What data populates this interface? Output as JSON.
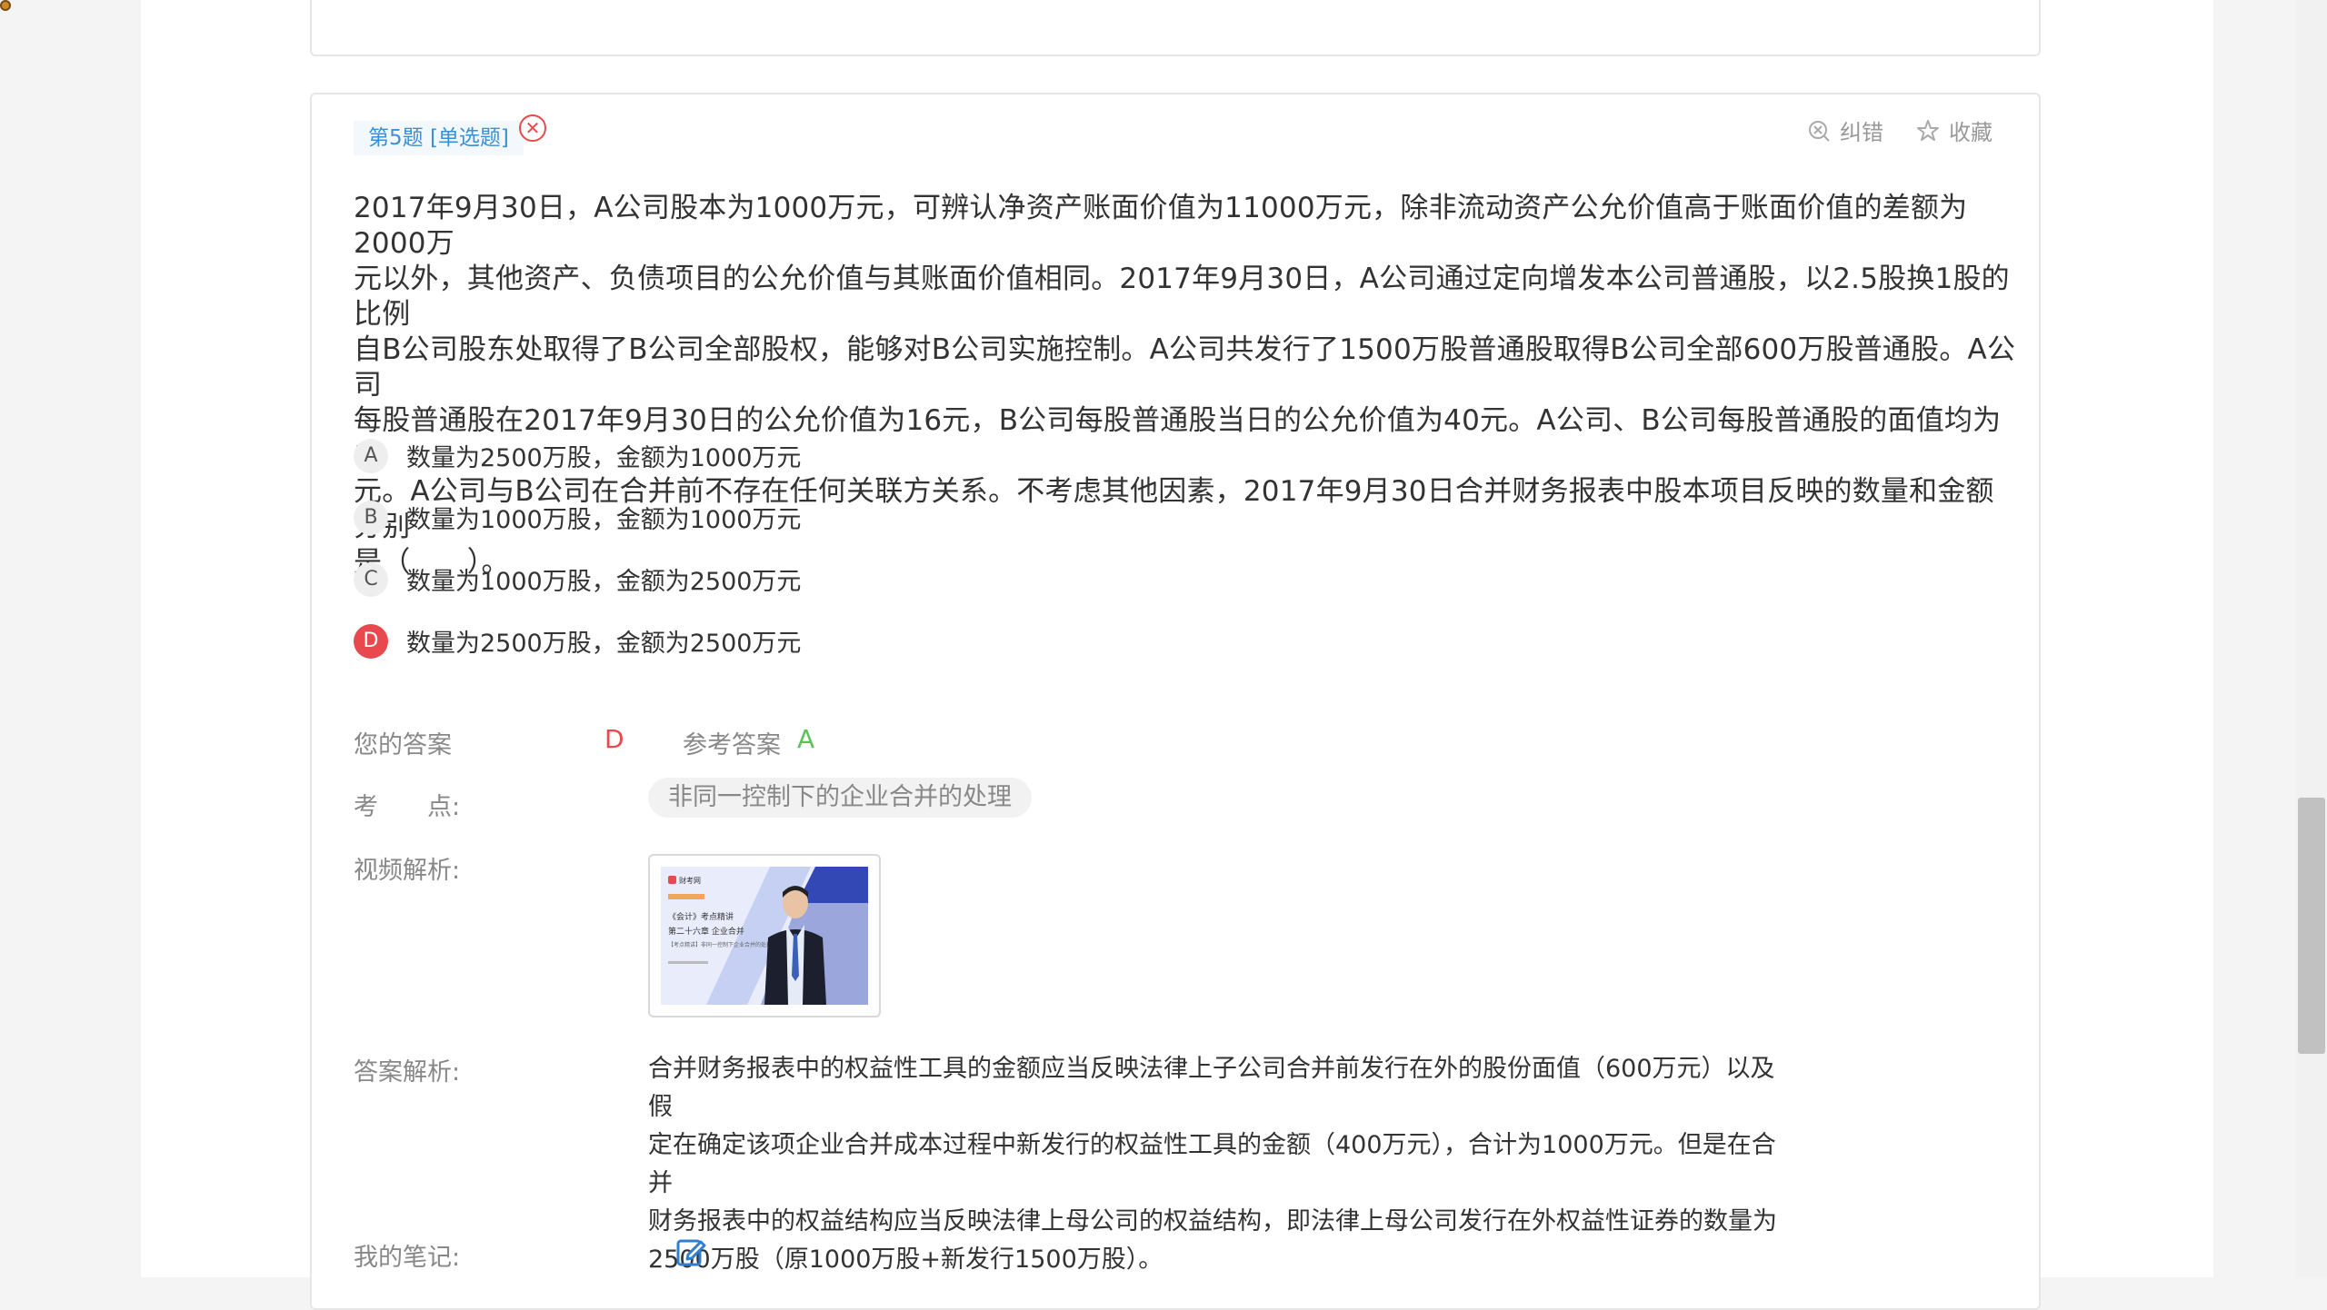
{
  "question": {
    "tag": "第5题 [单选题]",
    "status_symbol": "✕",
    "tools": {
      "report": "纠错",
      "favorite": "收藏"
    },
    "stem_lines": [
      "2017年9月30日，A公司股本为1000万元，可辨认净资产账面价值为11000万元，除非流动资产公允价值高于账面价值的差额为2000万",
      "元以外，其他资产、负债项目的公允价值与其账面价值相同。2017年9月30日，A公司通过定向增发本公司普通股，以2.5股换1股的比例",
      "自B公司股东处取得了B公司全部股权，能够对B公司实施控制。A公司共发行了1500万股普通股取得B公司全部600万股普通股。A公司",
      "每股普通股在2017年9月30日的公允价值为16元，B公司每股普通股当日的公允价值为40元。A公司、B公司每股普通股的面值均为1",
      "元。A公司与B公司在合并前不存在任何关联方关系。不考虑其他因素，2017年9月30日合并财务报表中股本项目反映的数量和金额分别",
      "是（　　）。"
    ],
    "options": [
      {
        "letter": "A",
        "text": "数量为2500万股，金额为1000万元"
      },
      {
        "letter": "B",
        "text": "数量为1000万股，金额为1000万元"
      },
      {
        "letter": "C",
        "text": "数量为1000万股，金额为2500万元"
      },
      {
        "letter": "D",
        "text": "数量为2500万股，金额为2500万元"
      }
    ],
    "selected_wrong_letter": "D",
    "answers": {
      "user_label": "您的答案",
      "user_value": "D",
      "ref_label": "参考答案",
      "ref_value": "A"
    },
    "knowledge": {
      "label": "考　　点:",
      "value": "非同一控制下的企业合并的处理"
    },
    "video": {
      "label": "视频解析:",
      "thumb_brand": "财考网",
      "thumb_lines": [
        "《会计》考点精讲",
        "第二十六章 企业合并",
        "【考点精讲】非同一控制下企业合并的处理"
      ]
    },
    "analysis": {
      "label": "答案解析:",
      "lines": [
        "合并财务报表中的权益性工具的金额应当反映法律上子公司合并前发行在外的股份面值（600万元）以及假",
        "定在确定该项企业合并成本过程中新发行的权益性工具的金额（400万元），合计为1000万元。但是在合并",
        "财务报表中的权益结构应当反映法律上母公司的权益结构，即法律上母公司发行在外权益性证券的数量为",
        "2500万股（原1000万股+新发行1500万股）。"
      ]
    },
    "notes": {
      "label": "我的笔记:"
    }
  },
  "colors": {
    "accent_blue": "#3b8fd6",
    "wrong_red": "#e8494e",
    "correct_green": "#5cc15a"
  }
}
